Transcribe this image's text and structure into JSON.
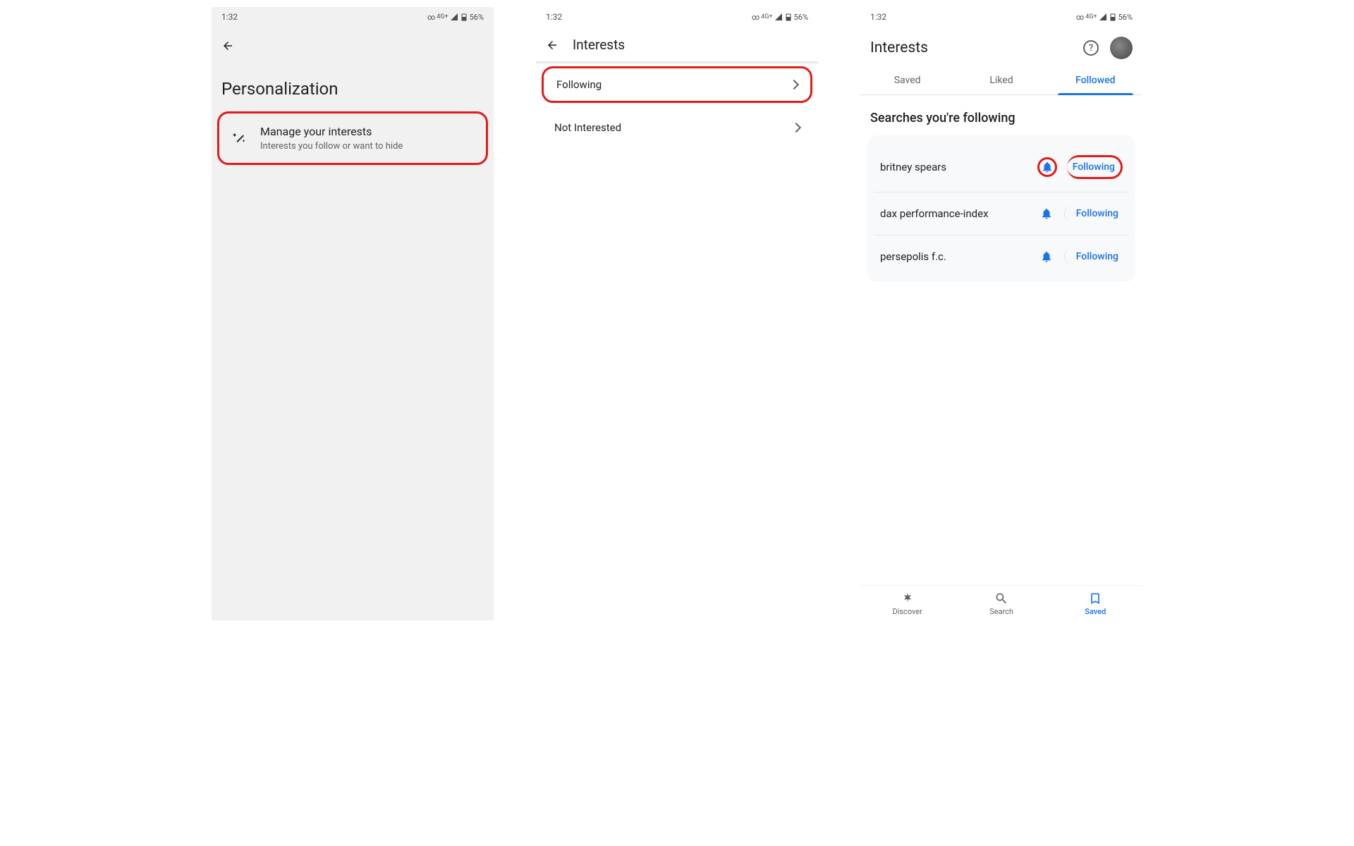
{
  "status": {
    "time": "1:32",
    "network": "4G+",
    "battery": "56%"
  },
  "screen1": {
    "title": "Personalization",
    "item": {
      "title": "Manage your interests",
      "subtitle": "Interests you follow or want to hide"
    }
  },
  "screen2": {
    "title": "Interests",
    "rows": [
      {
        "label": "Following"
      },
      {
        "label": "Not Interested"
      }
    ]
  },
  "screen3": {
    "title": "Interests",
    "tabs": {
      "saved": "Saved",
      "liked": "Liked",
      "followed": "Followed"
    },
    "section": "Searches you're following",
    "items": [
      {
        "label": "britney spears",
        "status": "Following"
      },
      {
        "label": "dax performance-index",
        "status": "Following"
      },
      {
        "label": "persepolis f.c.",
        "status": "Following"
      }
    ],
    "nav": {
      "discover": "Discover",
      "search": "Search",
      "saved": "Saved"
    }
  }
}
